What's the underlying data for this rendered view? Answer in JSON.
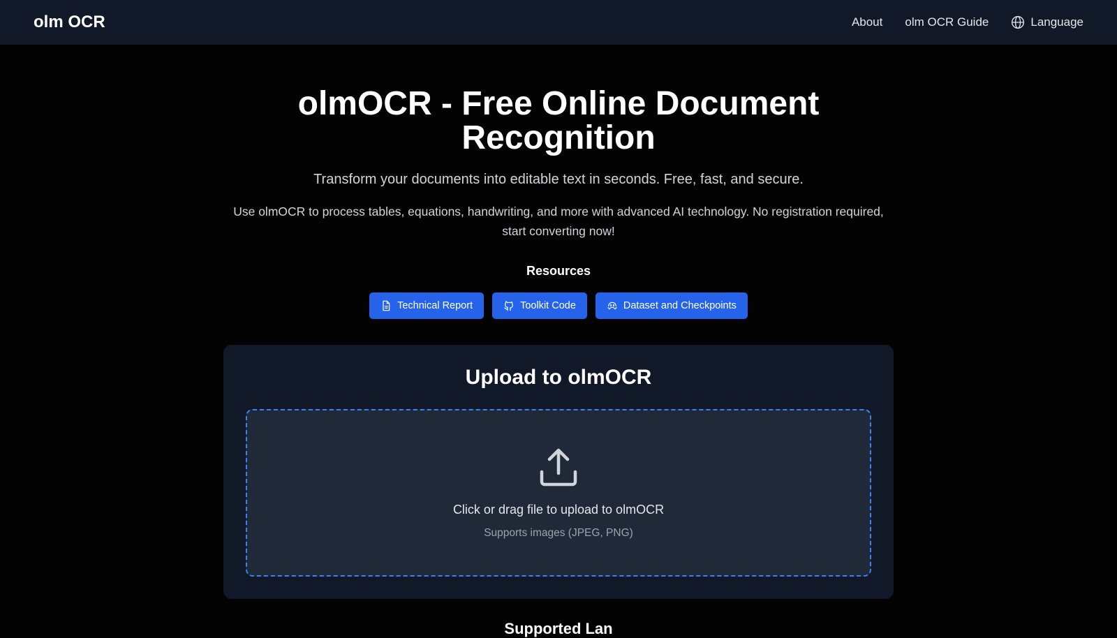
{
  "header": {
    "brand": "olm OCR",
    "nav": {
      "about": "About",
      "guide": "olm OCR Guide",
      "language": "Language"
    }
  },
  "hero": {
    "title": "olmOCR - Free Online Document Recognition",
    "subtitle": "Transform your documents into editable text in seconds. Free, fast, and secure.",
    "description": "Use olmOCR to process tables, equations, handwriting, and more with advanced AI technology. No registration required, start converting now!"
  },
  "resources": {
    "title": "Resources",
    "buttons": [
      {
        "label": "Technical Report",
        "icon": "document-icon"
      },
      {
        "label": "Toolkit Code",
        "icon": "github-icon"
      },
      {
        "label": "Dataset and Checkpoints",
        "icon": "huggingface-icon"
      }
    ]
  },
  "upload": {
    "title": "Upload to olmOCR",
    "dropzone_text": "Click or drag file to upload to olmOCR",
    "supports_text": "Supports images (JPEG, PNG)"
  },
  "next_section": {
    "title_partial": "Supported Lan"
  },
  "colors": {
    "background": "#030303",
    "header": "#111827",
    "accent": "#2563eb",
    "card": "#111827",
    "dropzone": "#1f2937",
    "dashed_border": "#3b82f6"
  }
}
